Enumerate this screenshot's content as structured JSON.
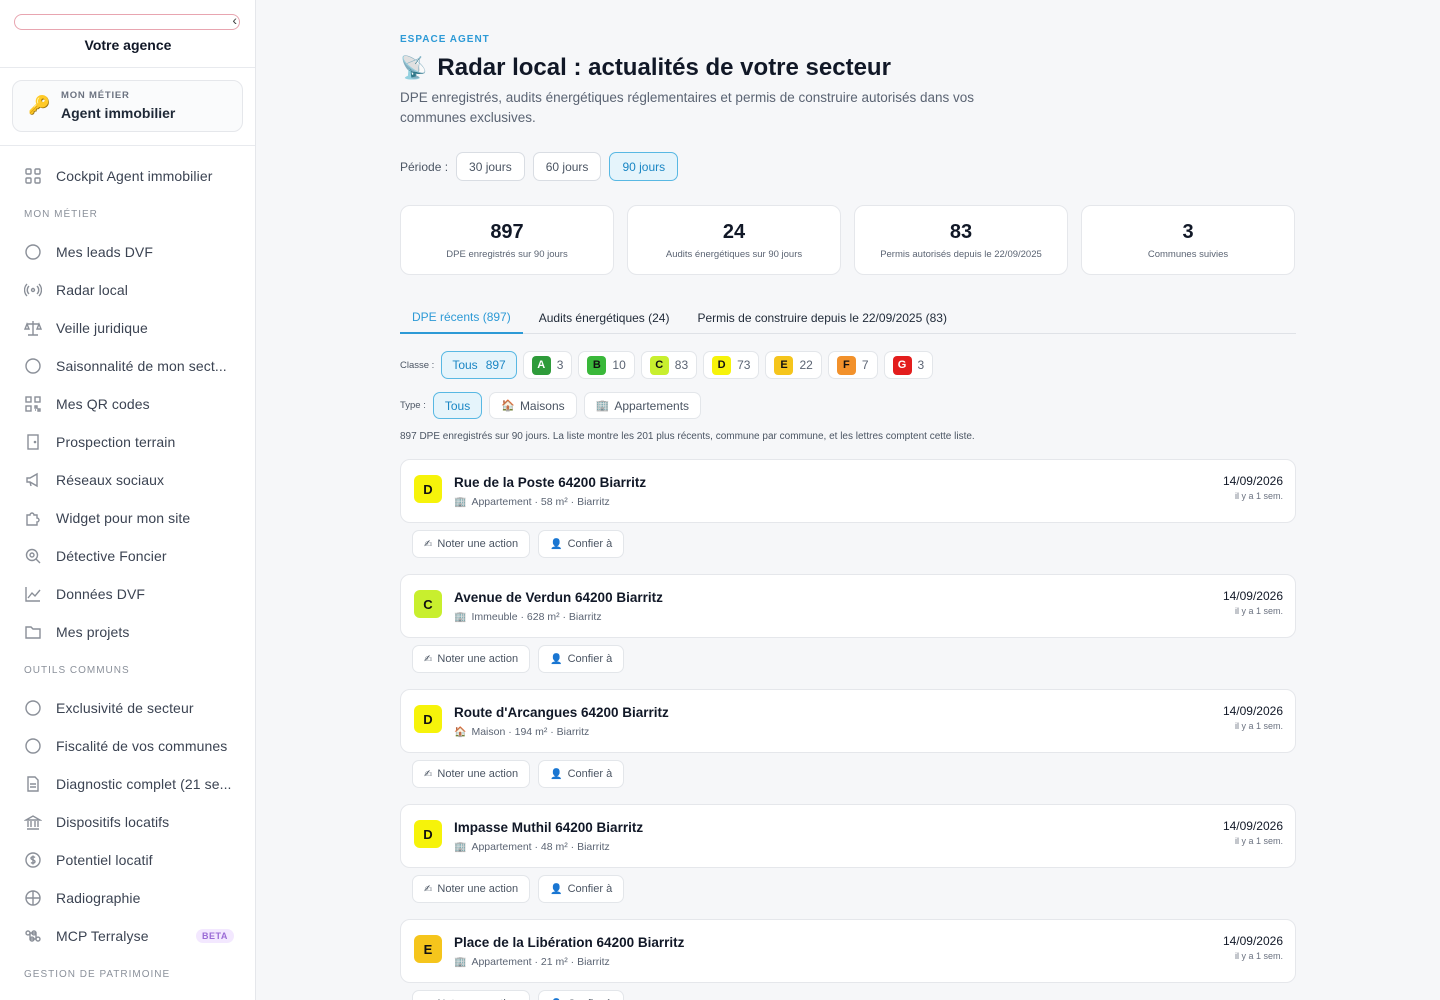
{
  "sidebar": {
    "agency_label": "Votre agence",
    "metier_small": "MON MÉTIER",
    "metier_value": "Agent immobilier",
    "items": [
      {
        "type": "item",
        "label": "Cockpit Agent immobilier",
        "icon": "grid-icon"
      },
      {
        "type": "section",
        "label": "MON MÉTIER"
      },
      {
        "type": "item",
        "label": "Mes leads DVF",
        "icon": "circle-icon"
      },
      {
        "type": "item",
        "label": "Radar local",
        "icon": "radar-icon"
      },
      {
        "type": "item",
        "label": "Veille juridique",
        "icon": "scales-icon"
      },
      {
        "type": "item",
        "label": "Saisonnalité de mon sect...",
        "icon": "circle-icon"
      },
      {
        "type": "item",
        "label": "Mes QR codes",
        "icon": "qr-icon"
      },
      {
        "type": "item",
        "label": "Prospection terrain",
        "icon": "door-icon"
      },
      {
        "type": "item",
        "label": "Réseaux sociaux",
        "icon": "megaphone-icon"
      },
      {
        "type": "item",
        "label": "Widget pour mon site",
        "icon": "puzzle-icon"
      },
      {
        "type": "item",
        "label": "Détective Foncier",
        "icon": "magnifier-icon"
      },
      {
        "type": "item",
        "label": "Données DVF",
        "icon": "chart-icon"
      },
      {
        "type": "item",
        "label": "Mes projets",
        "icon": "folder-icon"
      },
      {
        "type": "section",
        "label": "OUTILS COMMUNS"
      },
      {
        "type": "item",
        "label": "Exclusivité de secteur",
        "icon": "circle-icon"
      },
      {
        "type": "item",
        "label": "Fiscalité de vos communes",
        "icon": "circle-icon"
      },
      {
        "type": "item",
        "label": "Diagnostic complet (21 se...",
        "icon": "document-icon"
      },
      {
        "type": "item",
        "label": "Dispositifs locatifs",
        "icon": "bank-icon"
      },
      {
        "type": "item",
        "label": "Potentiel locatif",
        "icon": "dollar-icon"
      },
      {
        "type": "item",
        "label": "Radiographie",
        "icon": "crosshair-icon"
      },
      {
        "type": "item",
        "label": "MCP Terralyse",
        "icon": "command-icon",
        "badge": "BETA"
      },
      {
        "type": "section",
        "label": "GESTION DE PATRIMOINE"
      }
    ]
  },
  "header": {
    "eyebrow": "ESPACE AGENT",
    "title": "Radar local : actualités de votre secteur",
    "subtitle": "DPE enregistrés, audits énergétiques réglementaires et permis de construire autorisés dans vos communes exclusives."
  },
  "period": {
    "label": "Période :",
    "options": [
      "30 jours",
      "60 jours",
      "90 jours"
    ],
    "active": "90 jours"
  },
  "stats": [
    {
      "value": "897",
      "caption": "DPE enregistrés sur 90 jours"
    },
    {
      "value": "24",
      "caption": "Audits énergétiques sur 90 jours"
    },
    {
      "value": "83",
      "caption": "Permis autorisés depuis le 22/09/2025"
    },
    {
      "value": "3",
      "caption": "Communes suivies"
    }
  ],
  "tabs": [
    {
      "label": "DPE récents (897)",
      "active": true
    },
    {
      "label": "Audits énergétiques (24)",
      "active": false
    },
    {
      "label": "Permis de construire depuis le 22/09/2025 (83)",
      "active": false
    }
  ],
  "class_filter": {
    "label": "Classe :",
    "all_label": "Tous",
    "all_count": "897",
    "classes": [
      {
        "letter": "A",
        "count": "3",
        "color": "#2e9b3a",
        "text": "#ffffff"
      },
      {
        "letter": "B",
        "count": "10",
        "color": "#3ab83a",
        "text": "#111111"
      },
      {
        "letter": "C",
        "count": "83",
        "color": "#c8ef2e",
        "text": "#111111"
      },
      {
        "letter": "D",
        "count": "73",
        "color": "#f6f30a",
        "text": "#111111"
      },
      {
        "letter": "E",
        "count": "22",
        "color": "#f5c51c",
        "text": "#111111"
      },
      {
        "letter": "F",
        "count": "7",
        "color": "#f2912b",
        "text": "#111111"
      },
      {
        "letter": "G",
        "count": "3",
        "color": "#e31d1d",
        "text": "#ffffff"
      }
    ]
  },
  "type_filter": {
    "label": "Type :",
    "options": [
      {
        "label": "Tous",
        "icon": "",
        "active": true
      },
      {
        "label": "Maisons",
        "icon": "house-icon",
        "active": false
      },
      {
        "label": "Appartements",
        "icon": "building-icon",
        "active": false
      }
    ]
  },
  "note": "897 DPE enregistrés sur 90 jours. La liste montre les 201 plus récents, commune par commune, et les lettres comptent cette liste.",
  "entries": [
    {
      "grade": "D",
      "color": "#f6f30a",
      "address": "Rue de la Poste 64200 Biarritz",
      "meta": "Appartement · 58 m² · Biarritz",
      "date": "14/09/2026",
      "ago": "il y a 1 sem."
    },
    {
      "grade": "C",
      "color": "#c8ef2e",
      "address": "Avenue de Verdun 64200 Biarritz",
      "meta": "Immeuble · 628 m² · Biarritz",
      "date": "14/09/2026",
      "ago": "il y a 1 sem."
    },
    {
      "grade": "D",
      "color": "#f6f30a",
      "address": "Route d'Arcangues 64200 Biarritz",
      "meta": "Maison · 194 m² · Biarritz",
      "date": "14/09/2026",
      "ago": "il y a 1 sem."
    },
    {
      "grade": "D",
      "color": "#f6f30a",
      "address": "Impasse Muthil 64200 Biarritz",
      "meta": "Appartement · 48 m² · Biarritz",
      "date": "14/09/2026",
      "ago": "il y a 1 sem."
    },
    {
      "grade": "E",
      "color": "#f5c51c",
      "address": "Place de la Libération 64200 Biarritz",
      "meta": "Appartement · 21 m² · Biarritz",
      "date": "14/09/2026",
      "ago": "il y a 1 sem."
    }
  ],
  "actions": {
    "note_action": "Noter une action",
    "delegate": "Confier à"
  }
}
